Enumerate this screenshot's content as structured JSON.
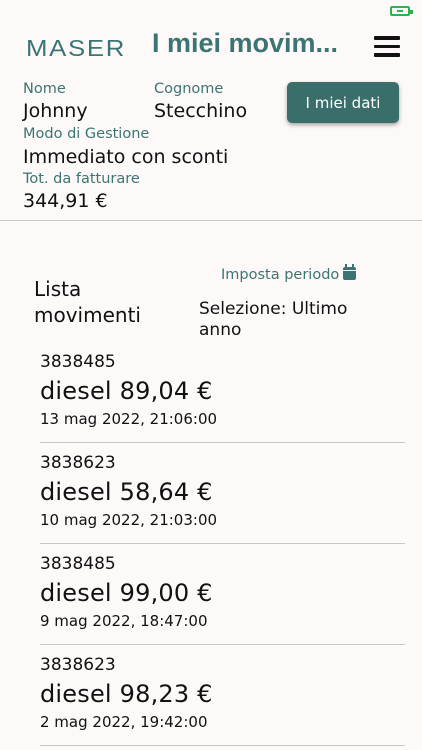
{
  "header": {
    "logo": "MASER",
    "title": "I miei movim..."
  },
  "profile": {
    "name_label": "Nome",
    "name_value": "Johnny",
    "surname_label": "Cognome",
    "surname_value": "Stecchino",
    "management_label": "Modo di Gestione",
    "management_value": "Immediato con sconti",
    "total_label": "Tot. da fatturare",
    "total_value": "344,91 €",
    "my_data_button": "I miei dati"
  },
  "list": {
    "title_line1": "Lista",
    "title_line2": "movimenti",
    "set_period_label": "Imposta periodo",
    "selection_text": "Selezione: Ultimo anno"
  },
  "movements": [
    {
      "id": "3838485",
      "amount": "diesel 89,04 €",
      "date": "13 mag 2022, 21:06:00"
    },
    {
      "id": "3838623",
      "amount": "diesel 58,64 €",
      "date": "10 mag 2022, 21:03:00"
    },
    {
      "id": "3838485",
      "amount": "diesel 99,00 €",
      "date": "9 mag 2022, 18:47:00"
    },
    {
      "id": "3838623",
      "amount": "diesel 98,23 €",
      "date": "2 mag 2022, 19:42:00"
    }
  ],
  "colors": {
    "accent": "#3b7573",
    "button": "#3a6e6b",
    "background": "#fdf9f8",
    "battery": "#2bb24c"
  }
}
